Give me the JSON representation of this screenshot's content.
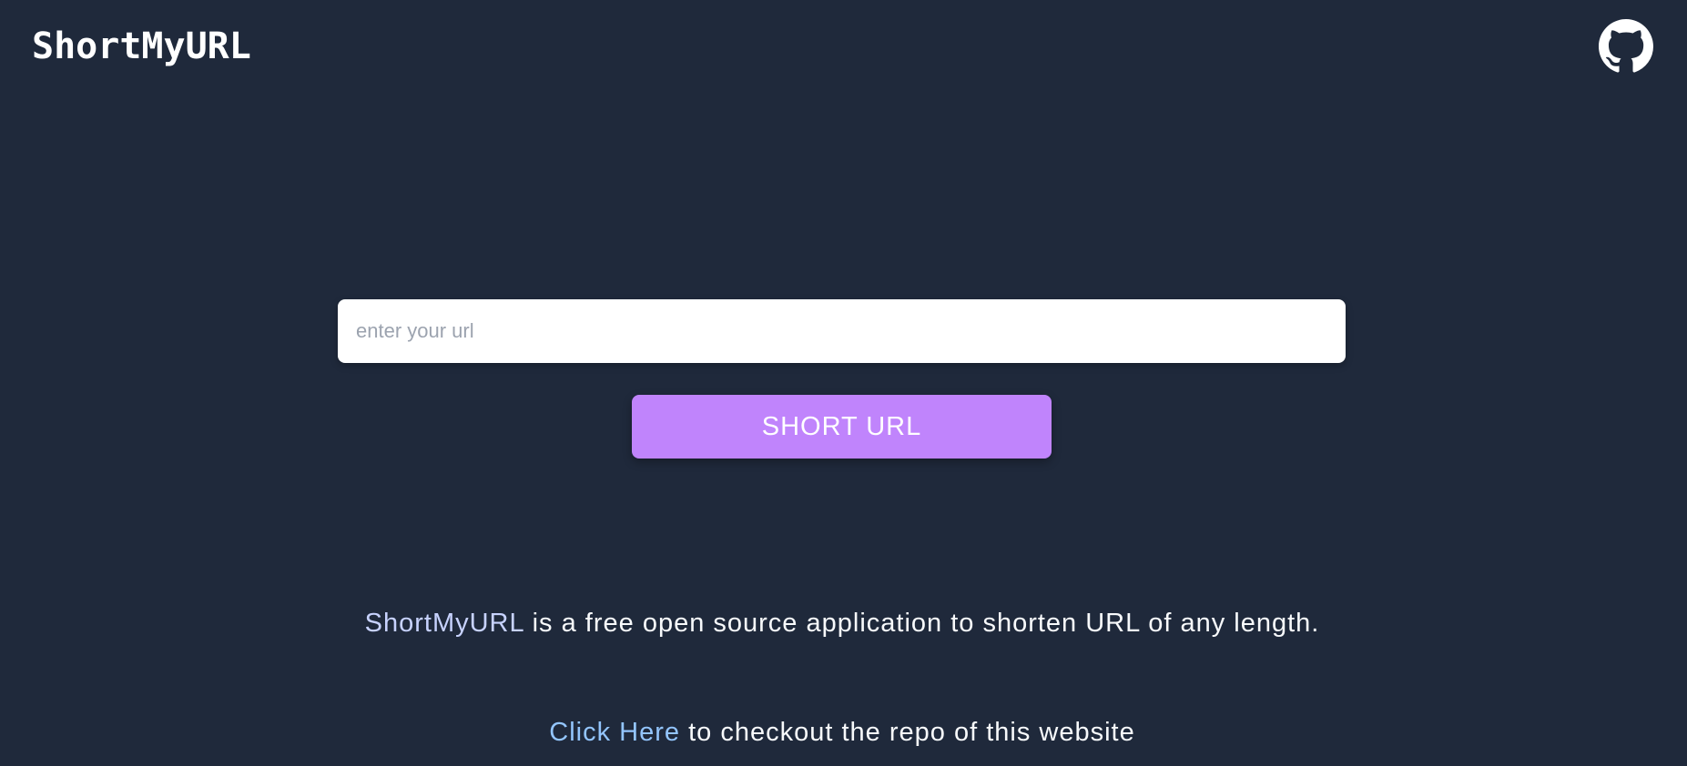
{
  "header": {
    "logo_text": "ShortMyURL",
    "github_icon": "github-icon"
  },
  "form": {
    "url_placeholder": "enter your url",
    "url_value": "",
    "submit_label": "SHORT URL"
  },
  "about": {
    "brand_name": "ShortMyURL",
    "description": " is a free open source application to shorten URL of any length."
  },
  "repo": {
    "link_text": "Click Here",
    "rest_text": " to checkout the repo of this website"
  },
  "colors": {
    "background": "#1f293b",
    "button": "#c084fc",
    "link": "#93c5fd",
    "brand_inline": "#c7d2fe"
  }
}
